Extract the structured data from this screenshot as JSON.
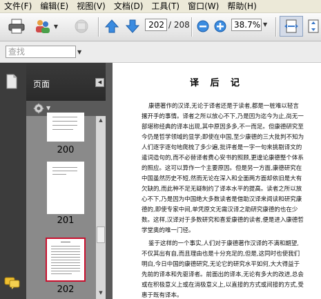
{
  "menu": [
    "文件(F)",
    "编辑(E)",
    "视图(V)",
    "文档(D)",
    "工具(T)",
    "窗口(W)",
    "帮助(H)"
  ],
  "toolbar": {
    "page_current": "202",
    "page_total": "/ 208",
    "zoom": "38.7%"
  },
  "search": {
    "placeholder": "查找"
  },
  "panel": {
    "title": "页面",
    "thumbnails": [
      "200",
      "201",
      "202"
    ]
  },
  "document": {
    "title": "译 后 记",
    "lines": [
      "康德著作的汉译,无论于译者还是于读者,都是一桩难以轻言",
      "撂开手的事情。译者之所以放心不下,乃是因为迄今为止,尚无一",
      "部堪称经典的译本出现,其中原因多多,不一而足。但康德研究至",
      "今仍是哲学领域的显学;即使在中国,至少康德的三大批判不知为",
      "人们逐字逐句地爬梳了多少遍,批评者是一字一句来挑剔译文的",
      "遣词造句的,而不必替译者费心安书的照顾,更遑论康德整个体系",
      "的照应。这可以算作一个主要原因。但是另一方面,康德研究在",
      "中国虽然历史不短,然而无论在深入和全面两方面却依旧是大有",
      "欠缺的,而此种不足无疑制约了译本水平的提高。读者之所以放",
      "心不下,乃是因为中国绝大多数读者是借助汉译来阅读和研究康",
      "德的,即使专家中间,单凭原文无需汉译之助研究康德的也在少",
      "数。这样,汉译对于多数研究和喜爱康德的读者,便是进入康德哲",
      "学堂奥的唯一门径。",
      "鉴于这样的一个事实,人们对于康德著作汉译的不满和期望,",
      "不仅其出有自,而且理由也是十分充足的,但是,这同时也使我们",
      "明白,今日中国的康德研究,无论它的研究水平如何,大大得益于",
      "先前的译本和先驱译者。前面出的译本,无论有多大的改进,总会",
      "或在积极意义上或在消极意义上,以直接的方式或间接的方式,受",
      "惠于既有译本。"
    ]
  }
}
